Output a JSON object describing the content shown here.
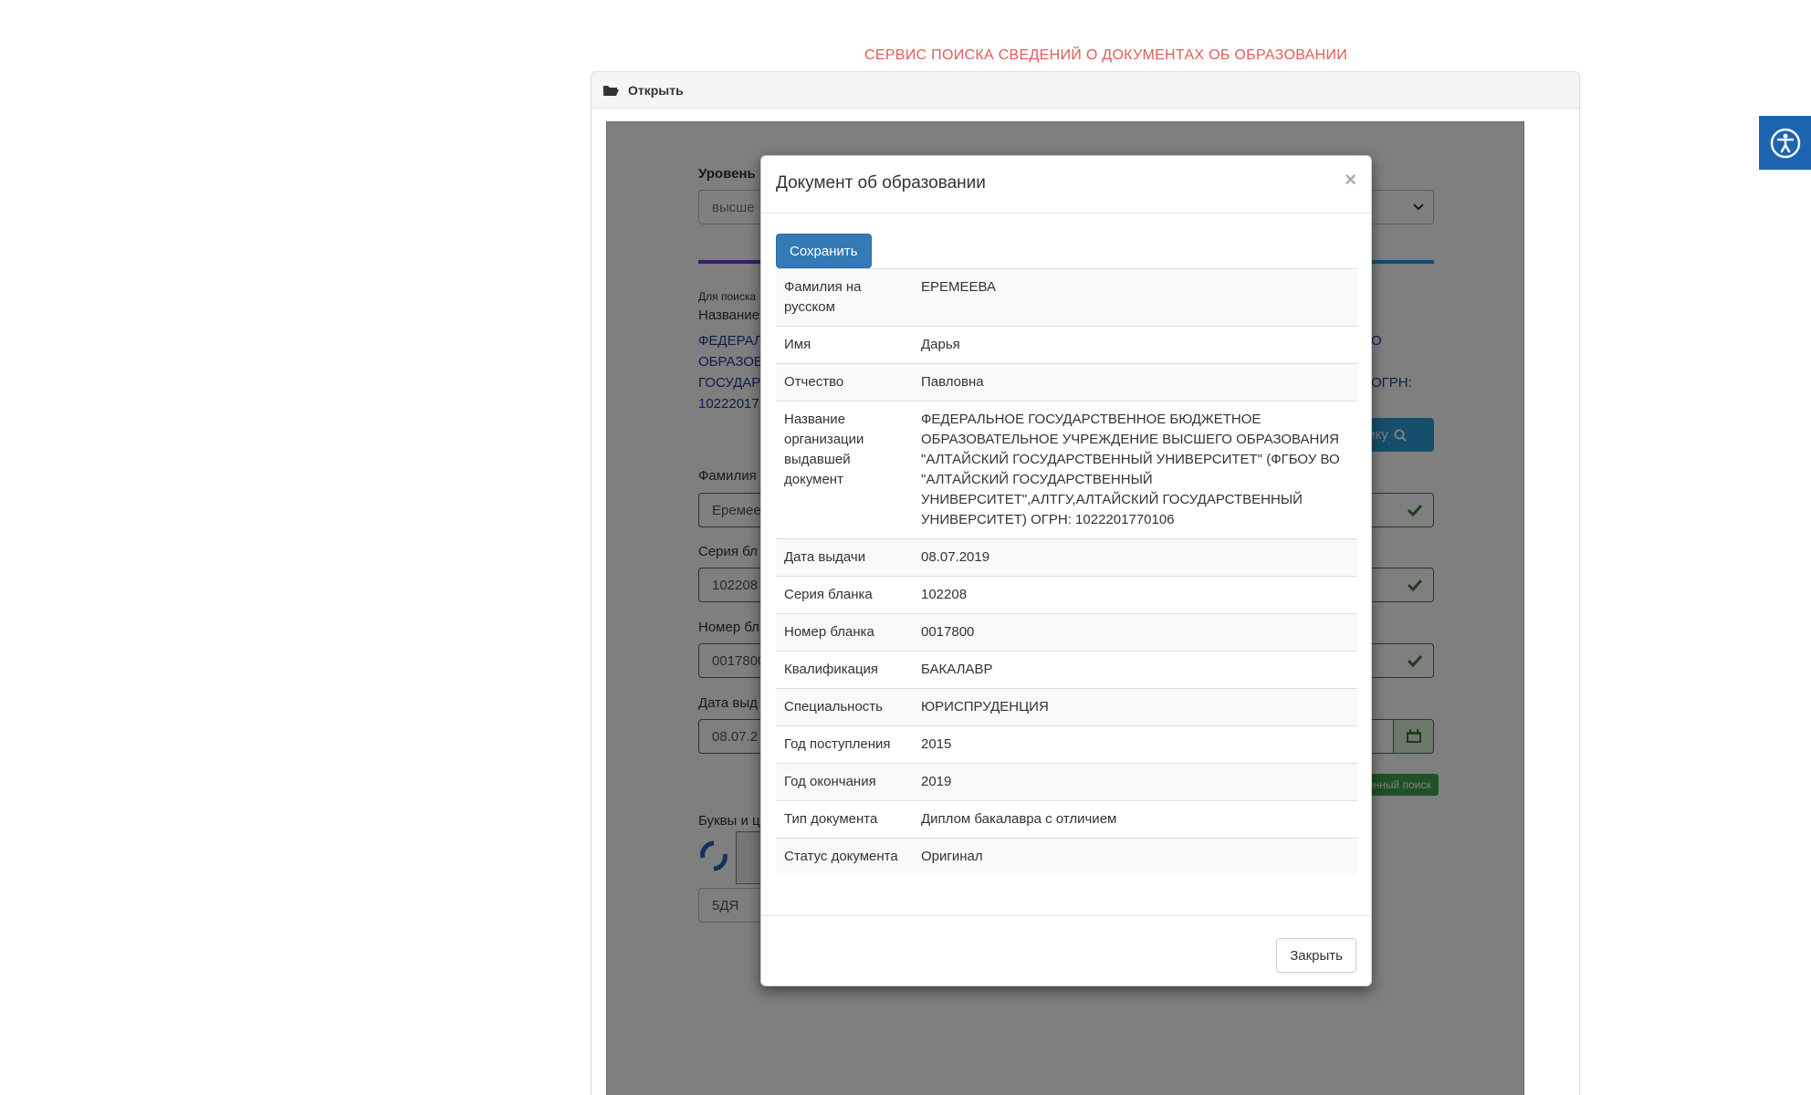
{
  "service_title": "СЕРВИС ПОИСКА СВЕДЕНИЙ О ДОКУМЕНТАХ ОБ ОБРАЗОВАНИИ",
  "panel": {
    "heading": "Открыть",
    "icon": "folder-open-icon"
  },
  "background_form": {
    "level_label": "Уровень",
    "level_value": "высше",
    "search_hint": "Для поиска",
    "org_label": "Название",
    "org_text_lines_left": [
      "ФЕДЕРАЛ",
      "ОБРАЗОВ",
      "ГОСУДАР",
      "10222017"
    ],
    "org_text_right_line1": "О",
    "org_text_right_line3": "ОГРН:",
    "search_button": "нику",
    "surname_label": "Фамилия",
    "surname_value": "Еремее",
    "series_label": "Серия бл",
    "series_value": "102208",
    "number_label": "Номер бл",
    "number_value": "0017800",
    "date_label": "Дата выд",
    "date_value": "08.07.2",
    "advanced_tag": "енный поиск",
    "captcha_label": "Буквы и ц",
    "captcha_value": "5ДЯ"
  },
  "accessibility": {
    "icon": "accessibility-icon"
  },
  "modal": {
    "title": "Документ об образовании",
    "close_symbol": "×",
    "save_button": "Сохранить",
    "close_button": "Закрыть",
    "rows": [
      {
        "label": "Фамилия на русском",
        "value": "ЕРЕМЕЕВА"
      },
      {
        "label": "Имя",
        "value": "Дарья"
      },
      {
        "label": "Отчество",
        "value": "Павловна"
      },
      {
        "label": "Название организации выдавшей документ",
        "value": "ФЕДЕРАЛЬНОЕ ГОСУДАРСТВЕННОЕ БЮДЖЕТНОЕ ОБРАЗОВАТЕЛЬНОЕ УЧРЕЖДЕНИЕ ВЫСШЕГО ОБРАЗОВАНИЯ \"АЛТАЙСКИЙ ГОСУДАРСТВЕННЫЙ УНИВЕРСИТЕТ\" (ФГБОУ ВО \"АЛТАЙСКИЙ ГОСУДАРСТВЕННЫЙ УНИВЕРСИТЕТ\",АЛТГУ,АЛТАЙСКИЙ ГОСУДАРСТВЕННЫЙ УНИВЕРСИТЕТ) ОГРН: 1022201770106"
      },
      {
        "label": "Дата выдачи",
        "value": "08.07.2019"
      },
      {
        "label": "Серия бланка",
        "value": "102208"
      },
      {
        "label": "Номер бланка",
        "value": "0017800"
      },
      {
        "label": "Квалификация",
        "value": "БАКАЛАВР"
      },
      {
        "label": "Специальность",
        "value": "ЮРИСПРУДЕНЦИЯ"
      },
      {
        "label": "Год поступления",
        "value": "2015"
      },
      {
        "label": "Год окончания",
        "value": "2019"
      },
      {
        "label": "Тип документа",
        "value": "Диплом бакалавра с отличием"
      },
      {
        "label": "Статус документа",
        "value": "Оригинал"
      }
    ]
  },
  "colors": {
    "title_red": "#e35b5b",
    "primary": "#337ab7",
    "accessibility_blue": "#1d64b1",
    "success_green": "#3c763d"
  }
}
